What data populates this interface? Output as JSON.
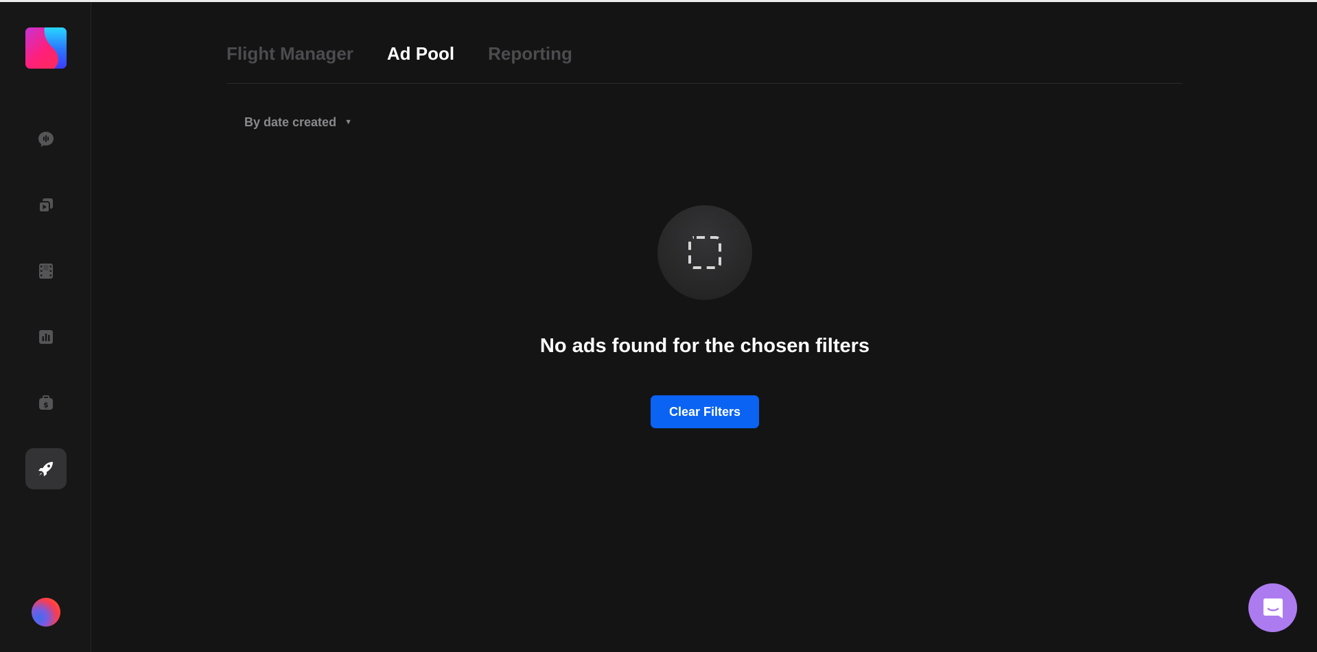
{
  "tabs": [
    {
      "label": "Flight Manager",
      "active": false
    },
    {
      "label": "Ad Pool",
      "active": true
    },
    {
      "label": "Reporting",
      "active": false
    }
  ],
  "sort": {
    "label": "By date created",
    "caret": "▼"
  },
  "empty_state": {
    "icon": "dashed-square-icon",
    "title": "No ads found for the chosen filters",
    "button_label": "Clear Filters"
  },
  "sidebar": {
    "logo": "brand-logo",
    "items": [
      {
        "icon": "podcast-chat-icon",
        "active": false
      },
      {
        "icon": "video-library-icon",
        "active": false
      },
      {
        "icon": "film-strip-icon",
        "active": false
      },
      {
        "icon": "bar-chart-icon",
        "active": false
      },
      {
        "icon": "money-bag-icon",
        "active": false
      },
      {
        "icon": "rocket-icon",
        "active": true
      }
    ],
    "avatar": "user-avatar"
  },
  "chat_widget": {
    "icon": "chat-bubble-icon"
  },
  "colors": {
    "background": "#141415",
    "sidebar": "#171717",
    "accent": "#0a63f2",
    "chat": "#ad7bf0",
    "inactive_text": "#4c4c4e"
  }
}
